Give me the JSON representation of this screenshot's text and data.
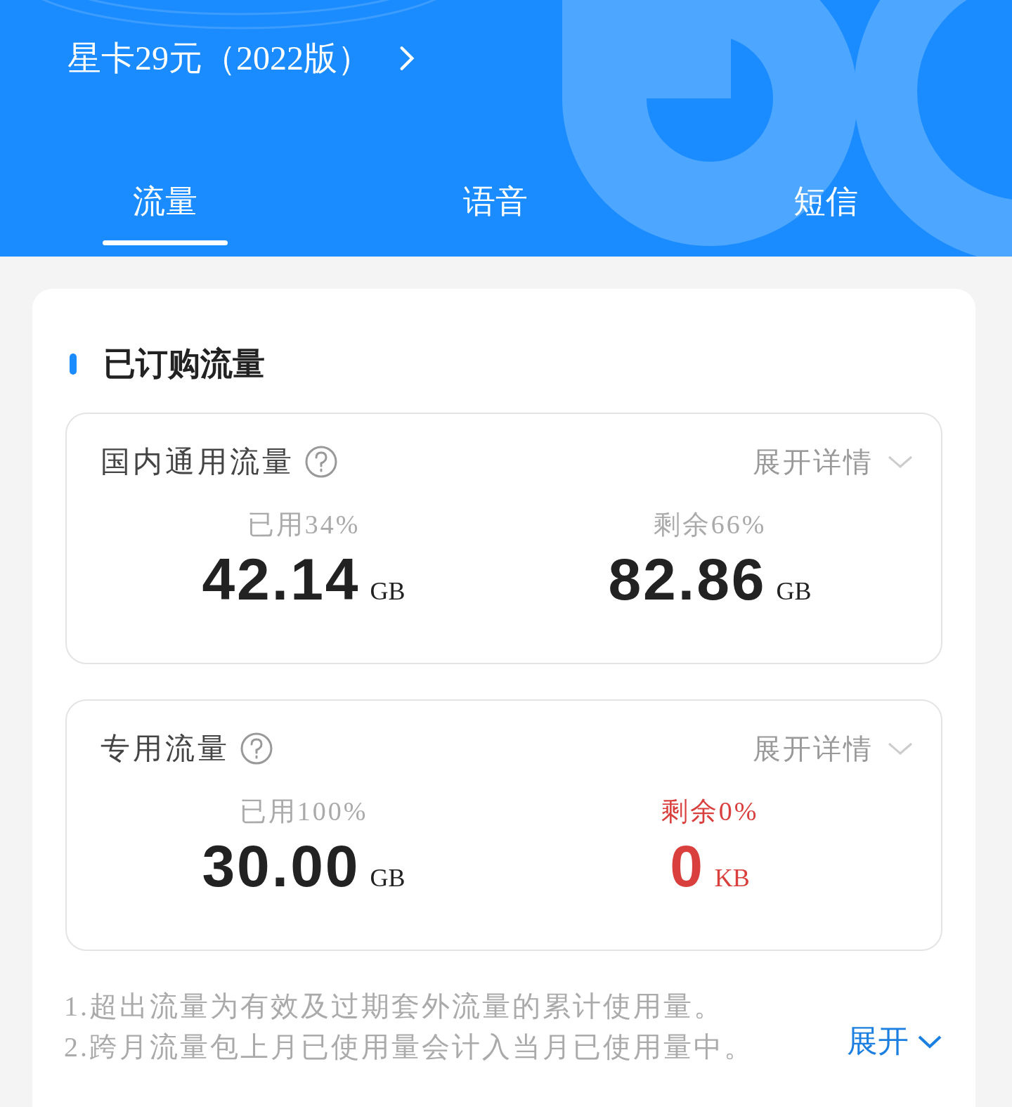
{
  "plan": {
    "title": "星卡29元（2022版）"
  },
  "tabs": [
    {
      "label": "流量",
      "selected": true
    },
    {
      "label": "语音",
      "selected": false
    },
    {
      "label": "短信",
      "selected": false
    }
  ],
  "section": {
    "title": "已订购流量"
  },
  "usages": [
    {
      "name": "国内通用流量",
      "details": "展开详情",
      "used_label": "已用34%",
      "used_value": "42.14",
      "used_unit": "GB",
      "remaining_label": "剩余66%",
      "remaining_value": "82.86",
      "remaining_unit": "GB",
      "exhausted": false
    },
    {
      "name": "专用流量",
      "details": "展开详情",
      "used_label": "已用100%",
      "used_value": "30.00",
      "used_unit": "GB",
      "remaining_label": "剩余0%",
      "remaining_value": "0",
      "remaining_unit": "KB",
      "exhausted": true
    }
  ],
  "notes": [
    "1.超出流量为有效及过期套外流量的累计使用量。",
    "2.跨月流量包上月已使用量会计入当月已使用量中。"
  ],
  "expand": "展开"
}
